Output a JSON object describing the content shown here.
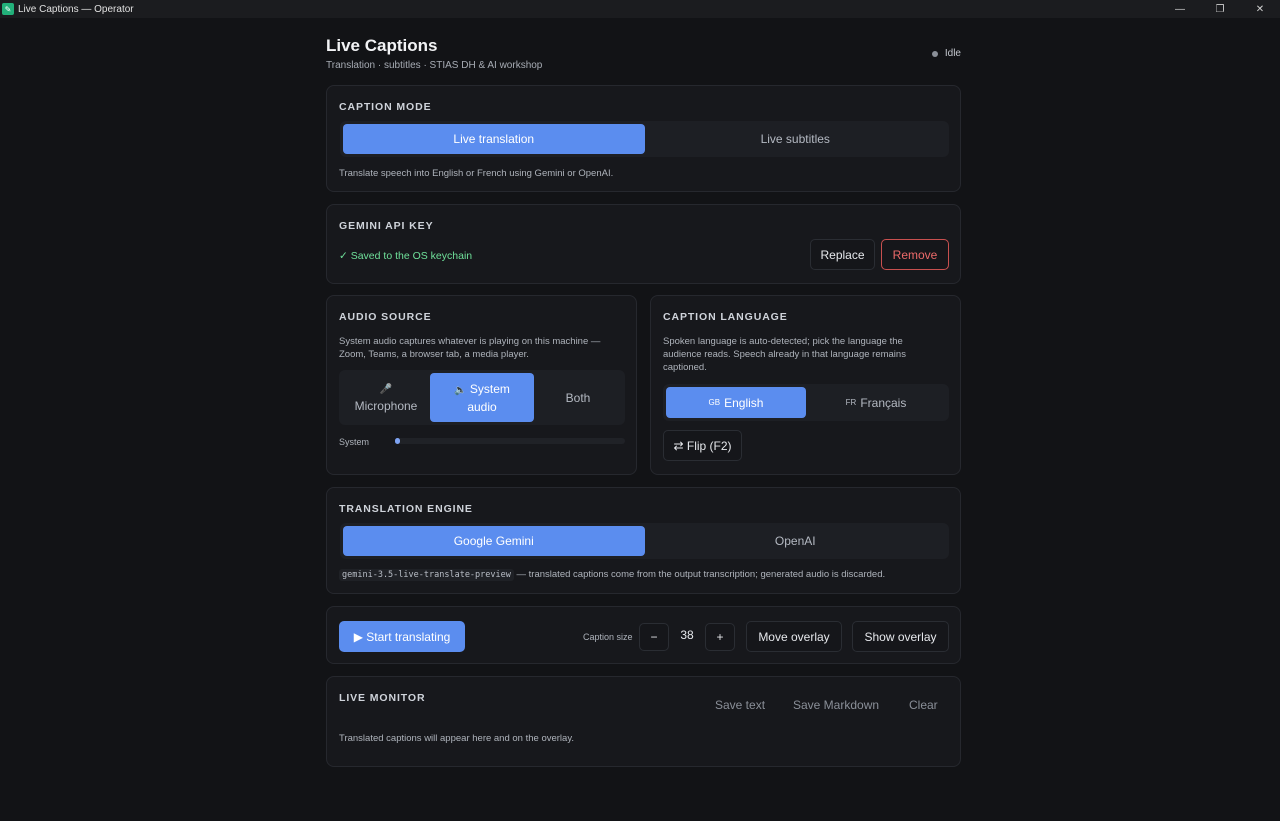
{
  "window": {
    "title": "Live Captions — Operator",
    "app_icon_glyph": "✎"
  },
  "header": {
    "title": "Live Captions",
    "subtitle": "Translation · subtitles · STIAS DH & AI workshop",
    "status": "Idle",
    "status_color": "#8a8f98"
  },
  "caption_mode": {
    "heading": "CAPTION MODE",
    "options": [
      "Live translation",
      "Live subtitles"
    ],
    "selected": "Live translation",
    "description": "Translate speech into English or French using Gemini or OpenAI."
  },
  "api_key": {
    "heading": "GEMINI API KEY",
    "status": "✓ Saved to the OS keychain",
    "replace_label": "Replace",
    "remove_label": "Remove"
  },
  "audio_source": {
    "heading": "AUDIO SOURCE",
    "description": "System audio captures whatever is playing on this machine — Zoom, Teams, a browser tab, a media player.",
    "options": [
      {
        "label": "Microphone",
        "icon": "microphone-icon",
        "glyph": "🎤"
      },
      {
        "label": "System audio",
        "icon": "speaker-icon",
        "glyph": "🔈"
      },
      {
        "label": "Both"
      }
    ],
    "selected": "System audio",
    "meter_label": "System",
    "meter_level": 0.01
  },
  "caption_language": {
    "heading": "CAPTION LANGUAGE",
    "description": "Spoken language is auto-detected; pick the language the audience reads. Speech already in that language remains captioned.",
    "options": [
      {
        "code": "GB",
        "label": "English"
      },
      {
        "code": "FR",
        "label": "Français"
      }
    ],
    "selected": "English",
    "flip_label": "⇄ Flip (F2)"
  },
  "engine": {
    "heading": "TRANSLATION ENGINE",
    "options": [
      "Google Gemini",
      "OpenAI"
    ],
    "selected": "Google Gemini",
    "model": "gemini-3.5-live-translate-preview",
    "note": " — translated captions come from the output transcription; generated audio is discarded."
  },
  "controls": {
    "start_label": "▶ Start translating",
    "caption_size_label": "Caption size",
    "minus": "−",
    "size_value": "38",
    "plus": "+",
    "move_label": "Move overlay",
    "show_label": "Show overlay"
  },
  "monitor": {
    "heading": "LIVE MONITOR",
    "save_text": "Save text",
    "save_md": "Save Markdown",
    "clear": "Clear",
    "placeholder": "Translated captions will appear here and on the overlay."
  },
  "colors": {
    "accent": "#5b8def",
    "success": "#6fe09a",
    "danger": "#ec6a6a"
  }
}
